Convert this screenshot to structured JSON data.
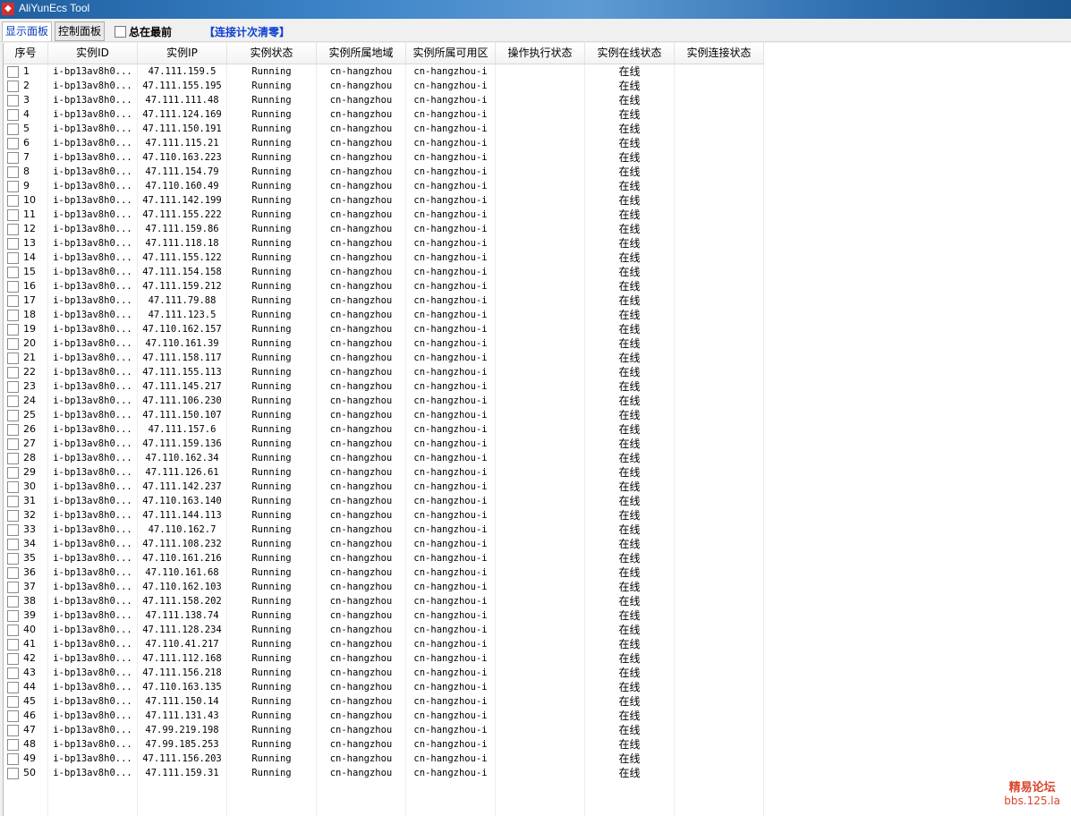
{
  "window": {
    "title": "AliYunEcs Tool"
  },
  "toolbar": {
    "tab_display": "显示面板",
    "tab_control": "控制面板",
    "always_on_top_label": "总在最前",
    "reset_link": "【连接计次清零】"
  },
  "table": {
    "columns": [
      "序号",
      "实例ID",
      "实例IP",
      "实例状态",
      "实例所属地域",
      "实例所属可用区",
      "操作执行状态",
      "实例在线状态",
      "实例连接状态"
    ],
    "rows": [
      {
        "no": "1",
        "id": "i-bp13av8h0...",
        "ip": "47.111.159.5",
        "status": "Running",
        "region": "cn-hangzhou",
        "zone": "cn-hangzhou-i",
        "op": "",
        "online": "在线",
        "conn": ""
      },
      {
        "no": "2",
        "id": "i-bp13av8h0...",
        "ip": "47.111.155.195",
        "status": "Running",
        "region": "cn-hangzhou",
        "zone": "cn-hangzhou-i",
        "op": "",
        "online": "在线",
        "conn": ""
      },
      {
        "no": "3",
        "id": "i-bp13av8h0...",
        "ip": "47.111.111.48",
        "status": "Running",
        "region": "cn-hangzhou",
        "zone": "cn-hangzhou-i",
        "op": "",
        "online": "在线",
        "conn": ""
      },
      {
        "no": "4",
        "id": "i-bp13av8h0...",
        "ip": "47.111.124.169",
        "status": "Running",
        "region": "cn-hangzhou",
        "zone": "cn-hangzhou-i",
        "op": "",
        "online": "在线",
        "conn": ""
      },
      {
        "no": "5",
        "id": "i-bp13av8h0...",
        "ip": "47.111.150.191",
        "status": "Running",
        "region": "cn-hangzhou",
        "zone": "cn-hangzhou-i",
        "op": "",
        "online": "在线",
        "conn": ""
      },
      {
        "no": "6",
        "id": "i-bp13av8h0...",
        "ip": "47.111.115.21",
        "status": "Running",
        "region": "cn-hangzhou",
        "zone": "cn-hangzhou-i",
        "op": "",
        "online": "在线",
        "conn": ""
      },
      {
        "no": "7",
        "id": "i-bp13av8h0...",
        "ip": "47.110.163.223",
        "status": "Running",
        "region": "cn-hangzhou",
        "zone": "cn-hangzhou-i",
        "op": "",
        "online": "在线",
        "conn": ""
      },
      {
        "no": "8",
        "id": "i-bp13av8h0...",
        "ip": "47.111.154.79",
        "status": "Running",
        "region": "cn-hangzhou",
        "zone": "cn-hangzhou-i",
        "op": "",
        "online": "在线",
        "conn": ""
      },
      {
        "no": "9",
        "id": "i-bp13av8h0...",
        "ip": "47.110.160.49",
        "status": "Running",
        "region": "cn-hangzhou",
        "zone": "cn-hangzhou-i",
        "op": "",
        "online": "在线",
        "conn": ""
      },
      {
        "no": "10",
        "id": "i-bp13av8h0...",
        "ip": "47.111.142.199",
        "status": "Running",
        "region": "cn-hangzhou",
        "zone": "cn-hangzhou-i",
        "op": "",
        "online": "在线",
        "conn": ""
      },
      {
        "no": "11",
        "id": "i-bp13av8h0...",
        "ip": "47.111.155.222",
        "status": "Running",
        "region": "cn-hangzhou",
        "zone": "cn-hangzhou-i",
        "op": "",
        "online": "在线",
        "conn": ""
      },
      {
        "no": "12",
        "id": "i-bp13av8h0...",
        "ip": "47.111.159.86",
        "status": "Running",
        "region": "cn-hangzhou",
        "zone": "cn-hangzhou-i",
        "op": "",
        "online": "在线",
        "conn": ""
      },
      {
        "no": "13",
        "id": "i-bp13av8h0...",
        "ip": "47.111.118.18",
        "status": "Running",
        "region": "cn-hangzhou",
        "zone": "cn-hangzhou-i",
        "op": "",
        "online": "在线",
        "conn": ""
      },
      {
        "no": "14",
        "id": "i-bp13av8h0...",
        "ip": "47.111.155.122",
        "status": "Running",
        "region": "cn-hangzhou",
        "zone": "cn-hangzhou-i",
        "op": "",
        "online": "在线",
        "conn": ""
      },
      {
        "no": "15",
        "id": "i-bp13av8h0...",
        "ip": "47.111.154.158",
        "status": "Running",
        "region": "cn-hangzhou",
        "zone": "cn-hangzhou-i",
        "op": "",
        "online": "在线",
        "conn": ""
      },
      {
        "no": "16",
        "id": "i-bp13av8h0...",
        "ip": "47.111.159.212",
        "status": "Running",
        "region": "cn-hangzhou",
        "zone": "cn-hangzhou-i",
        "op": "",
        "online": "在线",
        "conn": ""
      },
      {
        "no": "17",
        "id": "i-bp13av8h0...",
        "ip": "47.111.79.88",
        "status": "Running",
        "region": "cn-hangzhou",
        "zone": "cn-hangzhou-i",
        "op": "",
        "online": "在线",
        "conn": ""
      },
      {
        "no": "18",
        "id": "i-bp13av8h0...",
        "ip": "47.111.123.5",
        "status": "Running",
        "region": "cn-hangzhou",
        "zone": "cn-hangzhou-i",
        "op": "",
        "online": "在线",
        "conn": ""
      },
      {
        "no": "19",
        "id": "i-bp13av8h0...",
        "ip": "47.110.162.157",
        "status": "Running",
        "region": "cn-hangzhou",
        "zone": "cn-hangzhou-i",
        "op": "",
        "online": "在线",
        "conn": ""
      },
      {
        "no": "20",
        "id": "i-bp13av8h0...",
        "ip": "47.110.161.39",
        "status": "Running",
        "region": "cn-hangzhou",
        "zone": "cn-hangzhou-i",
        "op": "",
        "online": "在线",
        "conn": ""
      },
      {
        "no": "21",
        "id": "i-bp13av8h0...",
        "ip": "47.111.158.117",
        "status": "Running",
        "region": "cn-hangzhou",
        "zone": "cn-hangzhou-i",
        "op": "",
        "online": "在线",
        "conn": ""
      },
      {
        "no": "22",
        "id": "i-bp13av8h0...",
        "ip": "47.111.155.113",
        "status": "Running",
        "region": "cn-hangzhou",
        "zone": "cn-hangzhou-i",
        "op": "",
        "online": "在线",
        "conn": ""
      },
      {
        "no": "23",
        "id": "i-bp13av8h0...",
        "ip": "47.111.145.217",
        "status": "Running",
        "region": "cn-hangzhou",
        "zone": "cn-hangzhou-i",
        "op": "",
        "online": "在线",
        "conn": ""
      },
      {
        "no": "24",
        "id": "i-bp13av8h0...",
        "ip": "47.111.106.230",
        "status": "Running",
        "region": "cn-hangzhou",
        "zone": "cn-hangzhou-i",
        "op": "",
        "online": "在线",
        "conn": ""
      },
      {
        "no": "25",
        "id": "i-bp13av8h0...",
        "ip": "47.111.150.107",
        "status": "Running",
        "region": "cn-hangzhou",
        "zone": "cn-hangzhou-i",
        "op": "",
        "online": "在线",
        "conn": ""
      },
      {
        "no": "26",
        "id": "i-bp13av8h0...",
        "ip": "47.111.157.6",
        "status": "Running",
        "region": "cn-hangzhou",
        "zone": "cn-hangzhou-i",
        "op": "",
        "online": "在线",
        "conn": ""
      },
      {
        "no": "27",
        "id": "i-bp13av8h0...",
        "ip": "47.111.159.136",
        "status": "Running",
        "region": "cn-hangzhou",
        "zone": "cn-hangzhou-i",
        "op": "",
        "online": "在线",
        "conn": ""
      },
      {
        "no": "28",
        "id": "i-bp13av8h0...",
        "ip": "47.110.162.34",
        "status": "Running",
        "region": "cn-hangzhou",
        "zone": "cn-hangzhou-i",
        "op": "",
        "online": "在线",
        "conn": ""
      },
      {
        "no": "29",
        "id": "i-bp13av8h0...",
        "ip": "47.111.126.61",
        "status": "Running",
        "region": "cn-hangzhou",
        "zone": "cn-hangzhou-i",
        "op": "",
        "online": "在线",
        "conn": ""
      },
      {
        "no": "30",
        "id": "i-bp13av8h0...",
        "ip": "47.111.142.237",
        "status": "Running",
        "region": "cn-hangzhou",
        "zone": "cn-hangzhou-i",
        "op": "",
        "online": "在线",
        "conn": ""
      },
      {
        "no": "31",
        "id": "i-bp13av8h0...",
        "ip": "47.110.163.140",
        "status": "Running",
        "region": "cn-hangzhou",
        "zone": "cn-hangzhou-i",
        "op": "",
        "online": "在线",
        "conn": ""
      },
      {
        "no": "32",
        "id": "i-bp13av8h0...",
        "ip": "47.111.144.113",
        "status": "Running",
        "region": "cn-hangzhou",
        "zone": "cn-hangzhou-i",
        "op": "",
        "online": "在线",
        "conn": ""
      },
      {
        "no": "33",
        "id": "i-bp13av8h0...",
        "ip": "47.110.162.7",
        "status": "Running",
        "region": "cn-hangzhou",
        "zone": "cn-hangzhou-i",
        "op": "",
        "online": "在线",
        "conn": ""
      },
      {
        "no": "34",
        "id": "i-bp13av8h0...",
        "ip": "47.111.108.232",
        "status": "Running",
        "region": "cn-hangzhou",
        "zone": "cn-hangzhou-i",
        "op": "",
        "online": "在线",
        "conn": ""
      },
      {
        "no": "35",
        "id": "i-bp13av8h0...",
        "ip": "47.110.161.216",
        "status": "Running",
        "region": "cn-hangzhou",
        "zone": "cn-hangzhou-i",
        "op": "",
        "online": "在线",
        "conn": ""
      },
      {
        "no": "36",
        "id": "i-bp13av8h0...",
        "ip": "47.110.161.68",
        "status": "Running",
        "region": "cn-hangzhou",
        "zone": "cn-hangzhou-i",
        "op": "",
        "online": "在线",
        "conn": ""
      },
      {
        "no": "37",
        "id": "i-bp13av8h0...",
        "ip": "47.110.162.103",
        "status": "Running",
        "region": "cn-hangzhou",
        "zone": "cn-hangzhou-i",
        "op": "",
        "online": "在线",
        "conn": ""
      },
      {
        "no": "38",
        "id": "i-bp13av8h0...",
        "ip": "47.111.158.202",
        "status": "Running",
        "region": "cn-hangzhou",
        "zone": "cn-hangzhou-i",
        "op": "",
        "online": "在线",
        "conn": ""
      },
      {
        "no": "39",
        "id": "i-bp13av8h0...",
        "ip": "47.111.138.74",
        "status": "Running",
        "region": "cn-hangzhou",
        "zone": "cn-hangzhou-i",
        "op": "",
        "online": "在线",
        "conn": ""
      },
      {
        "no": "40",
        "id": "i-bp13av8h0...",
        "ip": "47.111.128.234",
        "status": "Running",
        "region": "cn-hangzhou",
        "zone": "cn-hangzhou-i",
        "op": "",
        "online": "在线",
        "conn": ""
      },
      {
        "no": "41",
        "id": "i-bp13av8h0...",
        "ip": "47.110.41.217",
        "status": "Running",
        "region": "cn-hangzhou",
        "zone": "cn-hangzhou-i",
        "op": "",
        "online": "在线",
        "conn": ""
      },
      {
        "no": "42",
        "id": "i-bp13av8h0...",
        "ip": "47.111.112.168",
        "status": "Running",
        "region": "cn-hangzhou",
        "zone": "cn-hangzhou-i",
        "op": "",
        "online": "在线",
        "conn": ""
      },
      {
        "no": "43",
        "id": "i-bp13av8h0...",
        "ip": "47.111.156.218",
        "status": "Running",
        "region": "cn-hangzhou",
        "zone": "cn-hangzhou-i",
        "op": "",
        "online": "在线",
        "conn": ""
      },
      {
        "no": "44",
        "id": "i-bp13av8h0...",
        "ip": "47.110.163.135",
        "status": "Running",
        "region": "cn-hangzhou",
        "zone": "cn-hangzhou-i",
        "op": "",
        "online": "在线",
        "conn": ""
      },
      {
        "no": "45",
        "id": "i-bp13av8h0...",
        "ip": "47.111.150.14",
        "status": "Running",
        "region": "cn-hangzhou",
        "zone": "cn-hangzhou-i",
        "op": "",
        "online": "在线",
        "conn": ""
      },
      {
        "no": "46",
        "id": "i-bp13av8h0...",
        "ip": "47.111.131.43",
        "status": "Running",
        "region": "cn-hangzhou",
        "zone": "cn-hangzhou-i",
        "op": "",
        "online": "在线",
        "conn": ""
      },
      {
        "no": "47",
        "id": "i-bp13av8h0...",
        "ip": "47.99.219.198",
        "status": "Running",
        "region": "cn-hangzhou",
        "zone": "cn-hangzhou-i",
        "op": "",
        "online": "在线",
        "conn": ""
      },
      {
        "no": "48",
        "id": "i-bp13av8h0...",
        "ip": "47.99.185.253",
        "status": "Running",
        "region": "cn-hangzhou",
        "zone": "cn-hangzhou-i",
        "op": "",
        "online": "在线",
        "conn": ""
      },
      {
        "no": "49",
        "id": "i-bp13av8h0...",
        "ip": "47.111.156.203",
        "status": "Running",
        "region": "cn-hangzhou",
        "zone": "cn-hangzhou-i",
        "op": "",
        "online": "在线",
        "conn": ""
      },
      {
        "no": "50",
        "id": "i-bp13av8h0...",
        "ip": "47.111.159.31",
        "status": "Running",
        "region": "cn-hangzhou",
        "zone": "cn-hangzhou-i",
        "op": "",
        "online": "在线",
        "conn": ""
      }
    ]
  },
  "watermark": {
    "line1": "精易论坛",
    "line2": "bbs.125.la"
  },
  "colors": {
    "accent_link": "#0b3ed4",
    "titlebar": "#3a82c6",
    "watermark": "#d8452a"
  }
}
